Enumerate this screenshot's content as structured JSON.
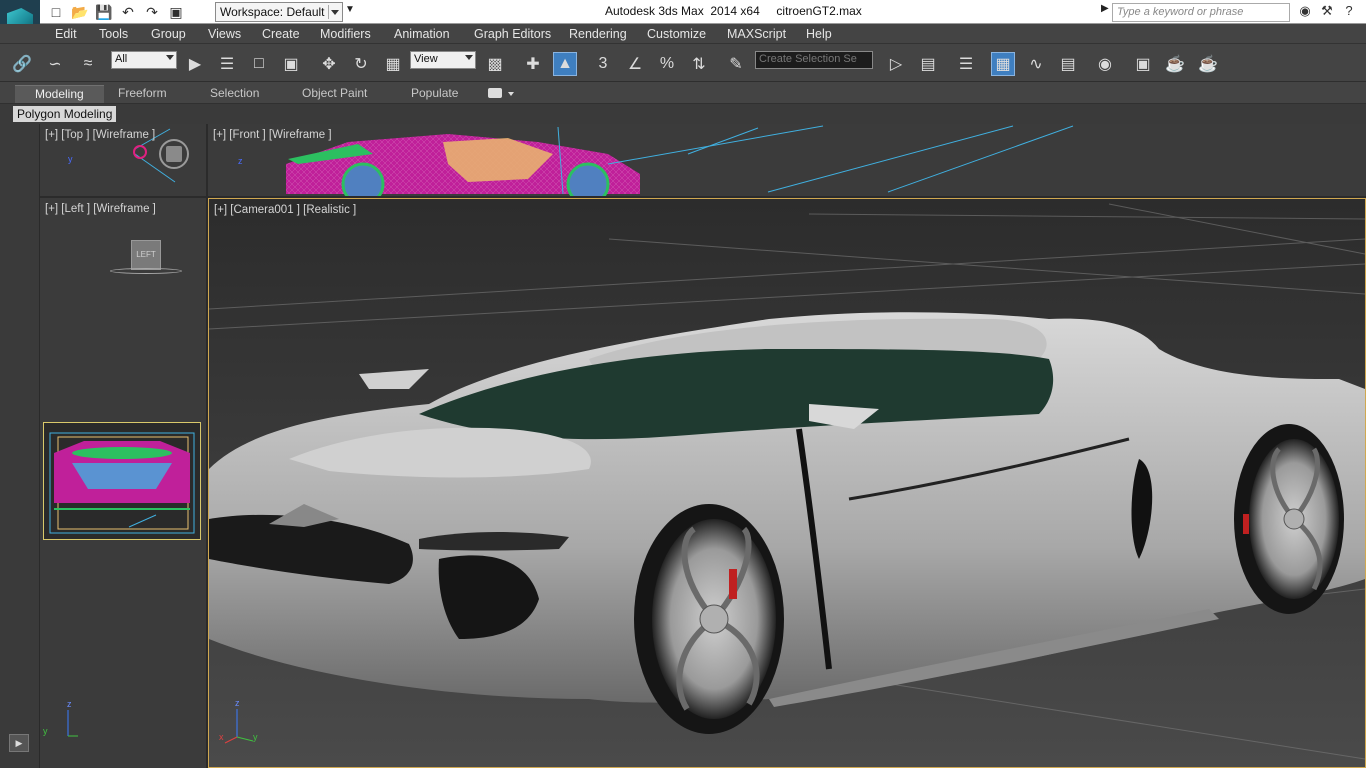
{
  "window": {
    "workspace_label": "Workspace: Default",
    "title": "Autodesk 3ds Max  2014 x64     citroenGT2.max",
    "search_placeholder": "Type a keyword or phrase"
  },
  "menu": [
    "Edit",
    "Tools",
    "Group",
    "Views",
    "Create",
    "Modifiers",
    "Animation",
    "Graph Editors",
    "Rendering",
    "Customize",
    "MAXScript",
    "Help"
  ],
  "toolbar": {
    "selection_filter": "All",
    "reference_coord": "View",
    "snap_value": "3",
    "named_selection_placeholder": "Create Selection Se"
  },
  "ribbon": {
    "tabs": [
      "Modeling",
      "Freeform",
      "Selection",
      "Object Paint",
      "Populate"
    ],
    "active_tab": "Modeling",
    "panel_label": "Polygon Modeling"
  },
  "viewports": {
    "top": "[+] [Top ] [Wireframe ]",
    "front": "[+] [Front ] [Wireframe ]",
    "left": "[+] [Left ] [Wireframe ]",
    "camera": "[+] [Camera001 ] [Realistic ]",
    "left_cube_label": "LEFT"
  },
  "axis_labels": {
    "x": "x",
    "y": "y",
    "z": "z"
  },
  "colors": {
    "active_viewport_border": "#d0a850",
    "toolbar_active": "#3f7fc0",
    "car_body": "#c8c8c8",
    "windshield": "#1f3a30",
    "wireframe_magenta": "#c0209a",
    "wireframe_green": "#2cc060",
    "wireframe_cyan": "#40b0e0"
  }
}
